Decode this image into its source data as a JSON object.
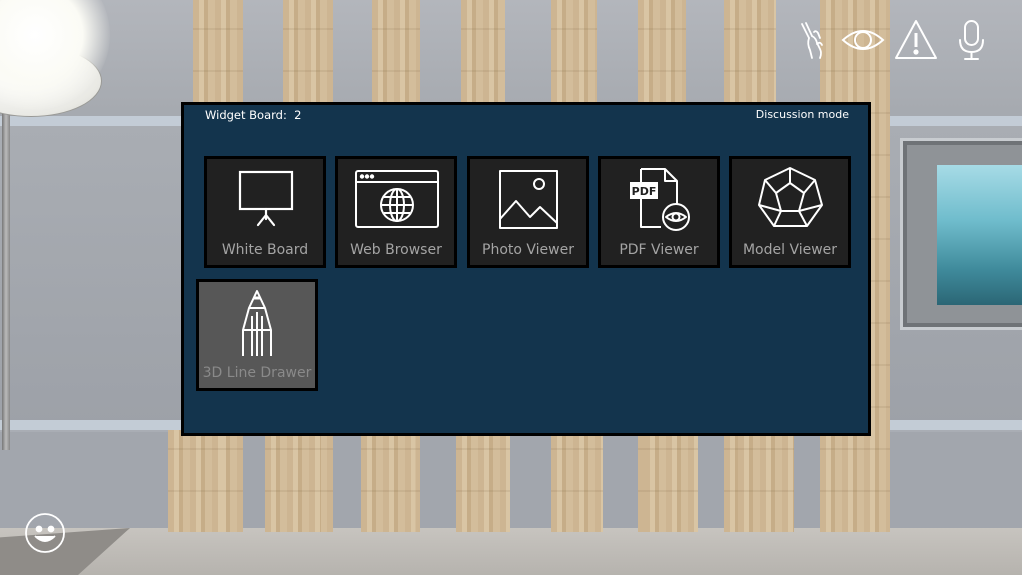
{
  "board": {
    "title": "Widget Board:  2",
    "mode": "Discussion mode",
    "widgets": [
      {
        "label": "White Board",
        "icon": "presentation-board-icon"
      },
      {
        "label": "Web Browser",
        "icon": "web-browser-icon"
      },
      {
        "label": "Photo Viewer",
        "icon": "photo-icon"
      },
      {
        "label": "PDF Viewer",
        "icon": "pdf-viewer-icon",
        "icon_text": "PDF"
      },
      {
        "label": "Model Viewer",
        "icon": "dodecahedron-icon"
      },
      {
        "label": "3D Line Drawer",
        "icon": "pencil-icon",
        "selected": true
      }
    ]
  },
  "hud": {
    "icons": [
      "hand-gesture-icon",
      "eye-icon",
      "warning-icon",
      "microphone-icon"
    ]
  },
  "emoji_button": {
    "icon": "smiley-face-icon"
  },
  "colors": {
    "board_bg": "#13344d",
    "tile_bg": "#212121",
    "tile_selected_bg": "#575757",
    "tile_label": "#a4a4a4",
    "icon_stroke": "#ffffff"
  }
}
